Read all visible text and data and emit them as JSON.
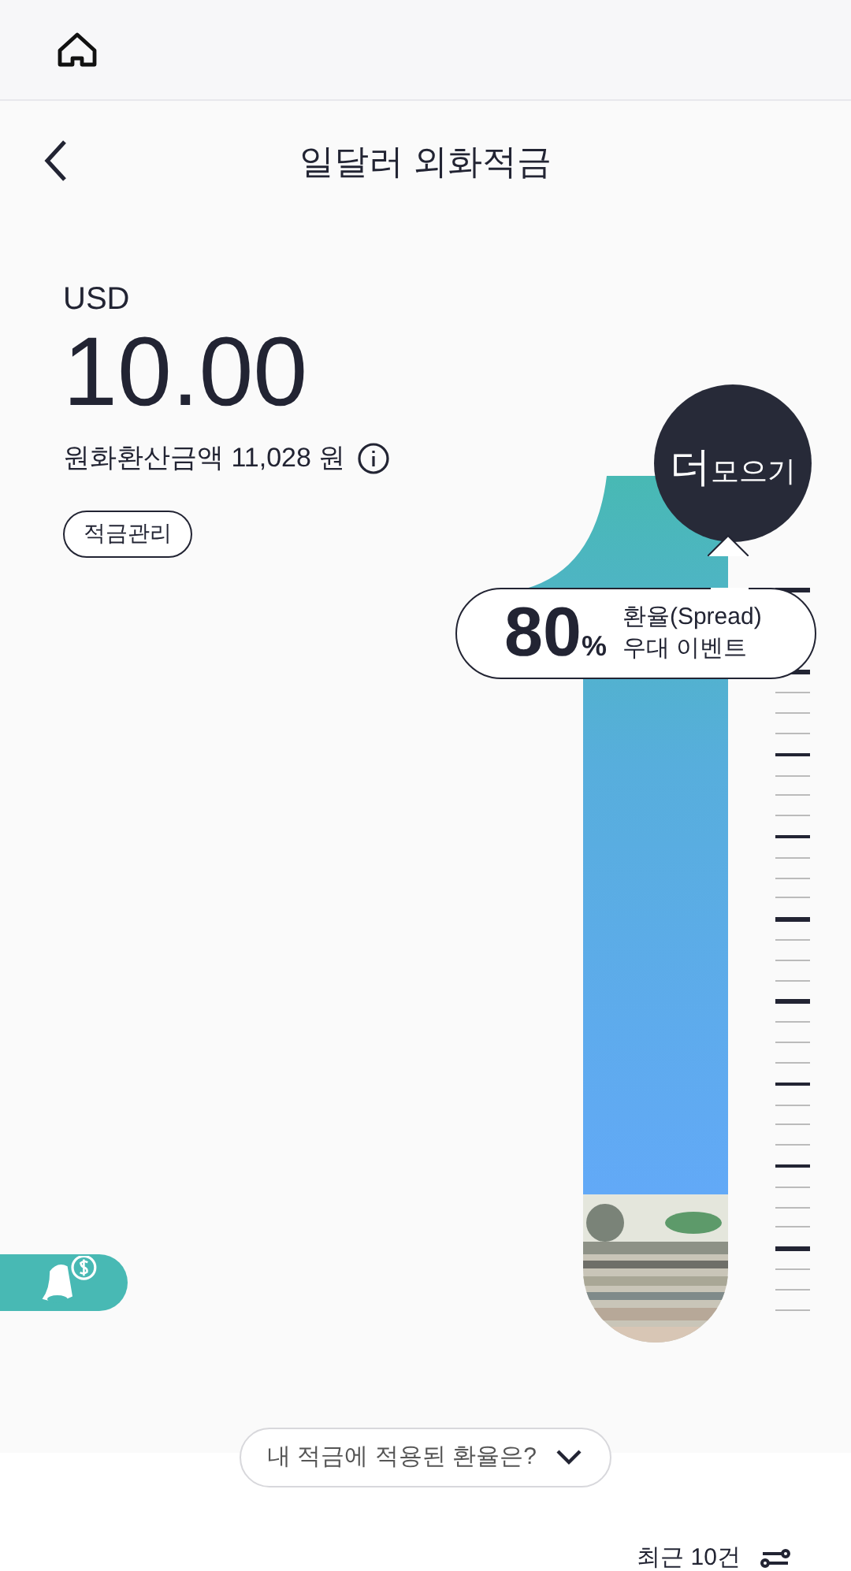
{
  "header": {
    "title": "일달러 외화적금"
  },
  "balance": {
    "currency": "USD",
    "amount": "10.00",
    "converted": "원화환산금액 11,028 원"
  },
  "manage_button": "적금관리",
  "save_more": {
    "big": "더",
    "small": "모으기"
  },
  "event": {
    "percent": "80",
    "unit": "%",
    "line1": "환율(Spread)",
    "line2": "우대 이벤트"
  },
  "rate_question": "내 적금에 적용된 환율은?",
  "recent": "최근 10건"
}
